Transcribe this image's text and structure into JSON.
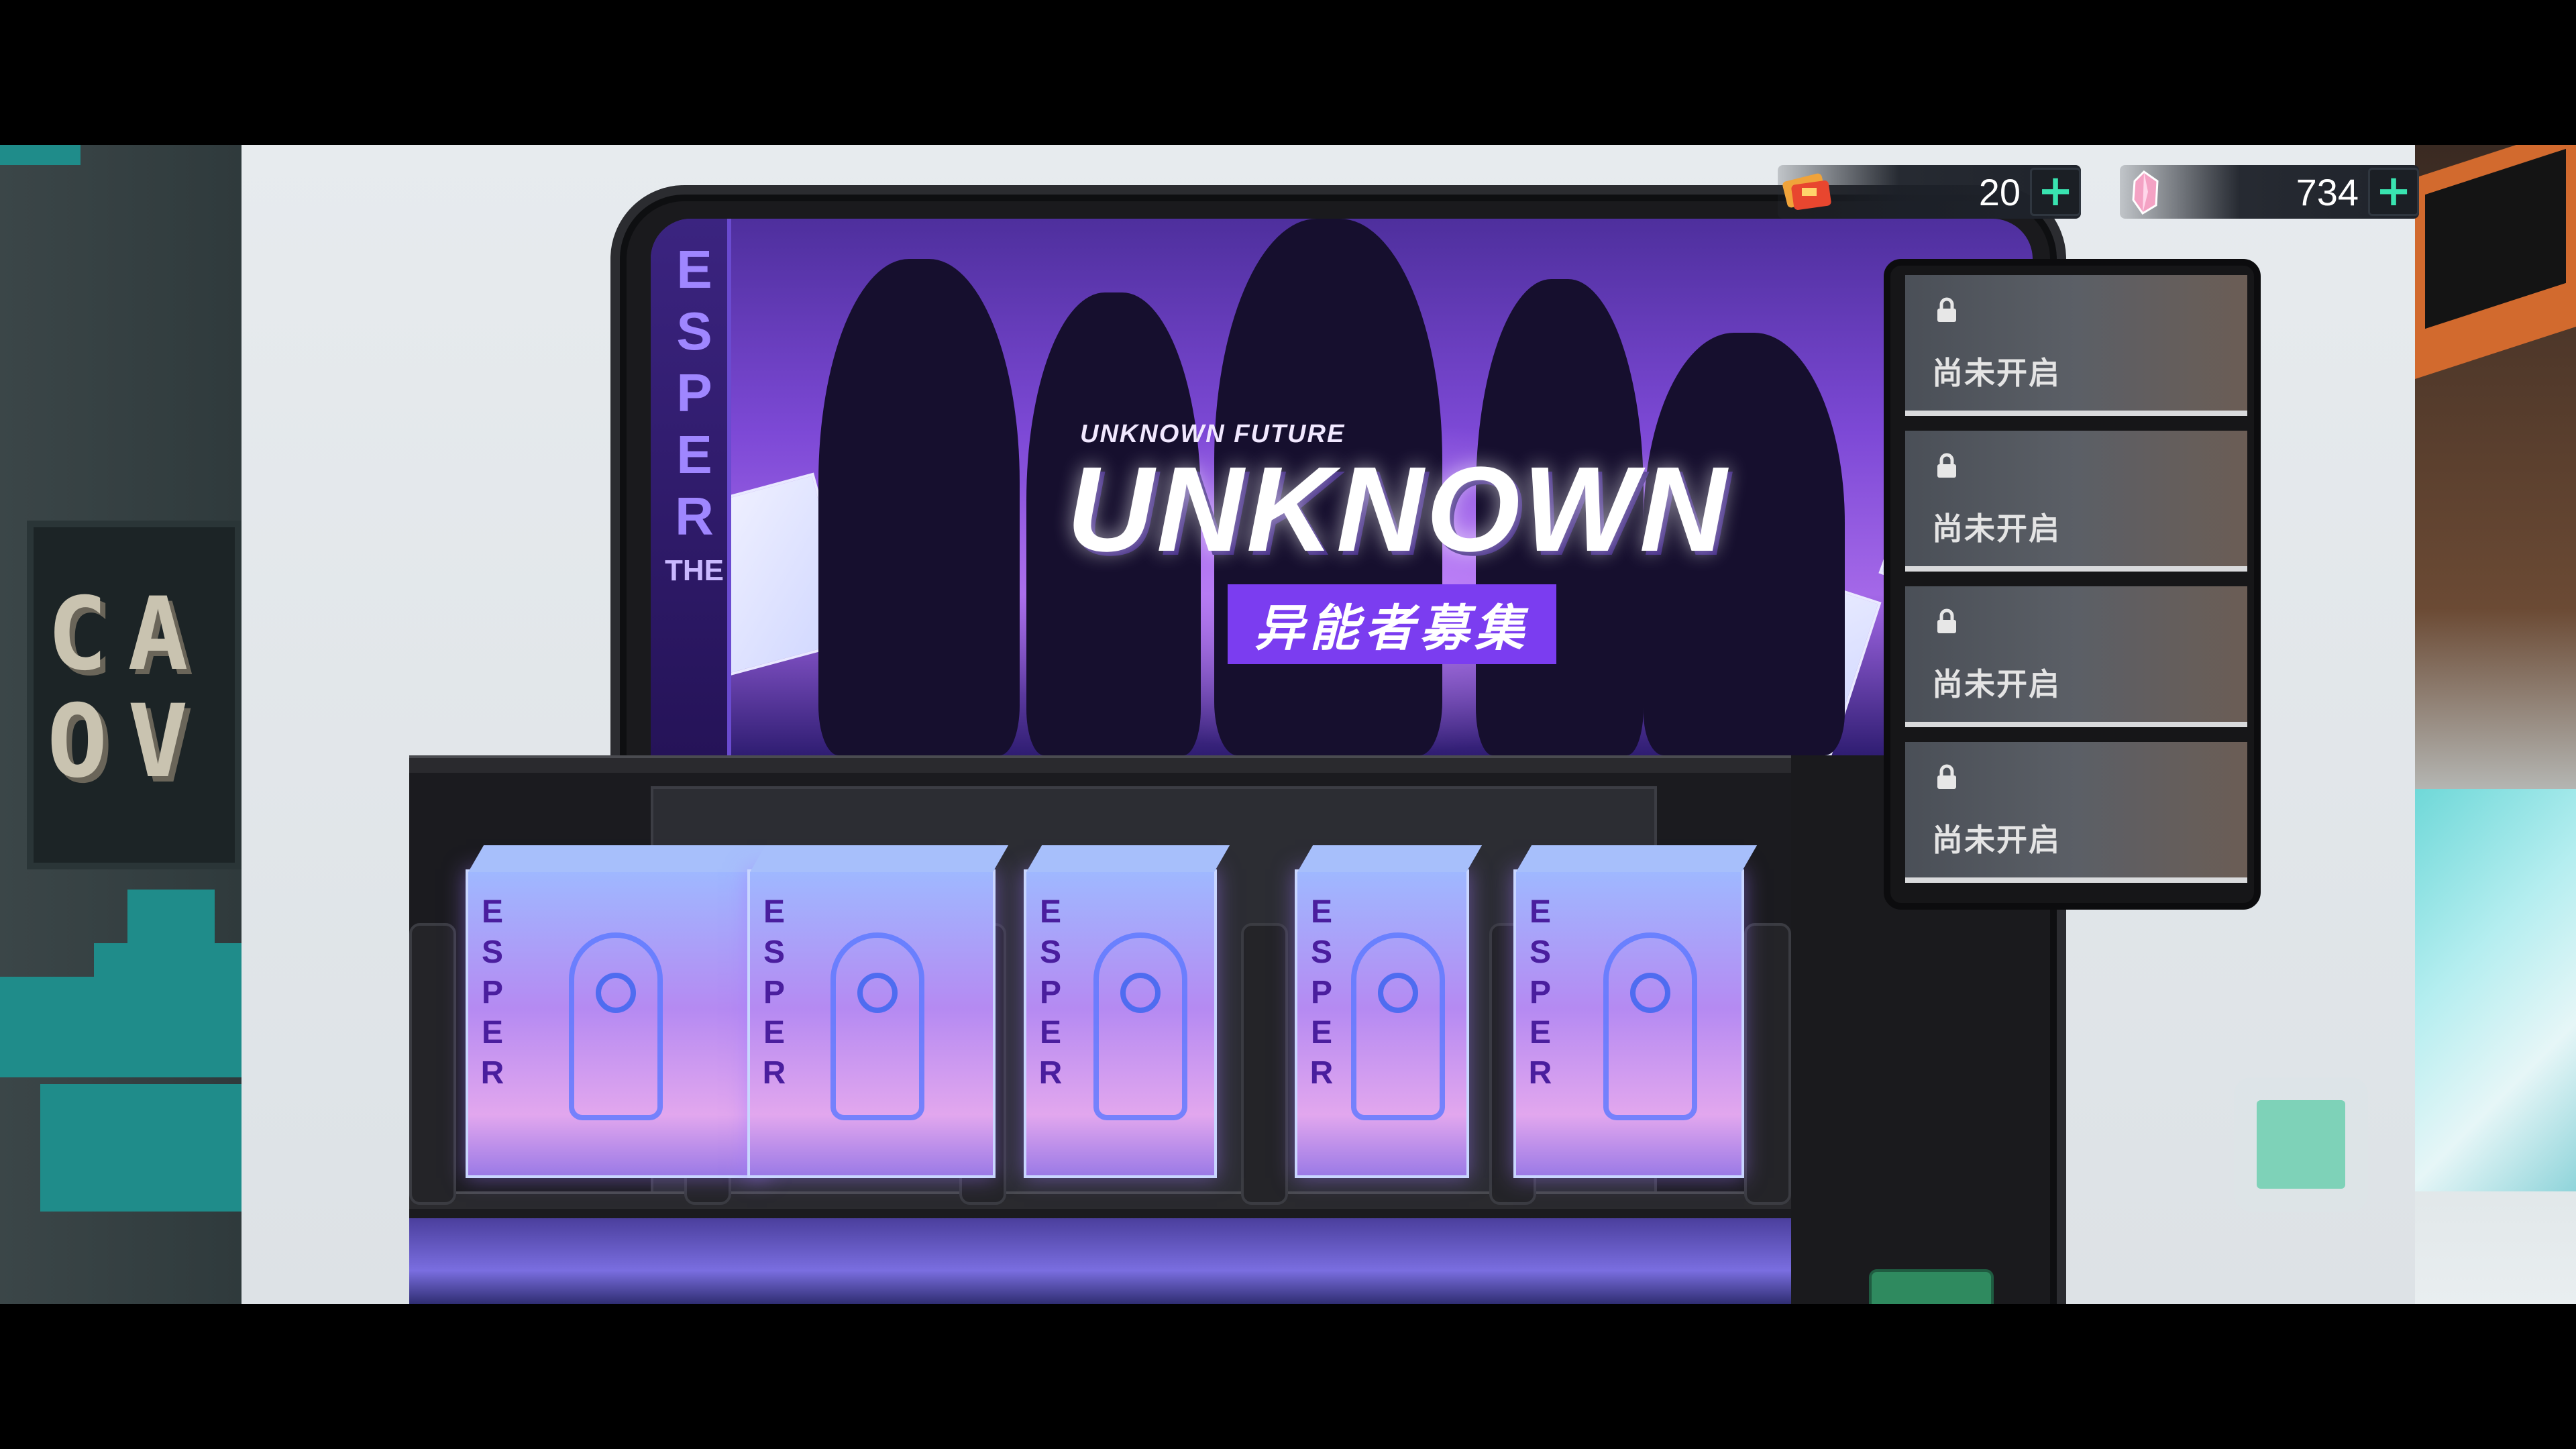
{
  "banner": {
    "side_text": "ESPER",
    "side_sub": "THE",
    "subtitle_small": "UNKNOWN FUTURE",
    "title": "UNKNOWN",
    "subtitle": "异能者募集"
  },
  "currencies": [
    {
      "name": "ticket",
      "icon": "ticket-icon",
      "value": "20",
      "color": "#f0a33a"
    },
    {
      "name": "crystal",
      "icon": "pink-crystal-icon",
      "value": "734",
      "color": "#f4a2c4"
    }
  ],
  "plus_label": "+",
  "slots": [
    {
      "label": "尚未开启",
      "icon": "lock-icon"
    },
    {
      "label": "尚未开启",
      "icon": "lock-icon"
    },
    {
      "label": "尚未开启",
      "icon": "lock-icon"
    },
    {
      "label": "尚未开启",
      "icon": "lock-icon"
    }
  ],
  "boxes": [
    {
      "spine": "ESPER"
    },
    {
      "spine": "ESPER"
    },
    {
      "spine": "ESPER"
    },
    {
      "spine": "ESPER"
    },
    {
      "spine": "ESPER"
    }
  ],
  "left_wall_sign": "CA\nOV",
  "colors": {
    "accent_green": "#39e3b0",
    "banner_purple": "#7b3df0",
    "machine_white": "#e7ebee"
  }
}
